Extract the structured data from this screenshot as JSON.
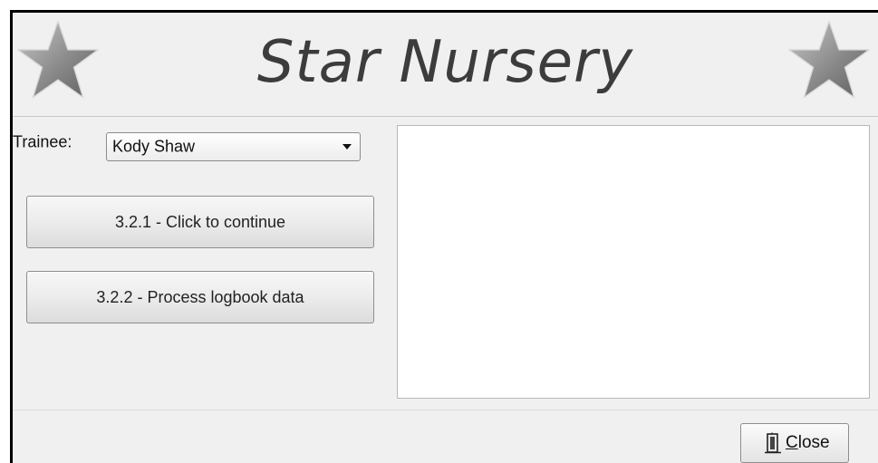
{
  "app": {
    "title": "Star Nursery"
  },
  "trainee": {
    "label": "Trainee:",
    "selected": "Kody Shaw"
  },
  "actions": {
    "continue_label": "3.2.1 - Click to continue",
    "process_label": "3.2.2 - Process logbook data"
  },
  "footer": {
    "close_mnemonic": "C",
    "close_rest": "lose"
  },
  "icons": {
    "header_left": "star-icon",
    "header_right": "star-icon",
    "close": "door-exit-icon",
    "dropdown": "chevron-down-icon"
  },
  "colors": {
    "window_bg": "#f0f0f0",
    "title_text": "#3c3c3c",
    "star_fill": "#8a8a8a"
  }
}
